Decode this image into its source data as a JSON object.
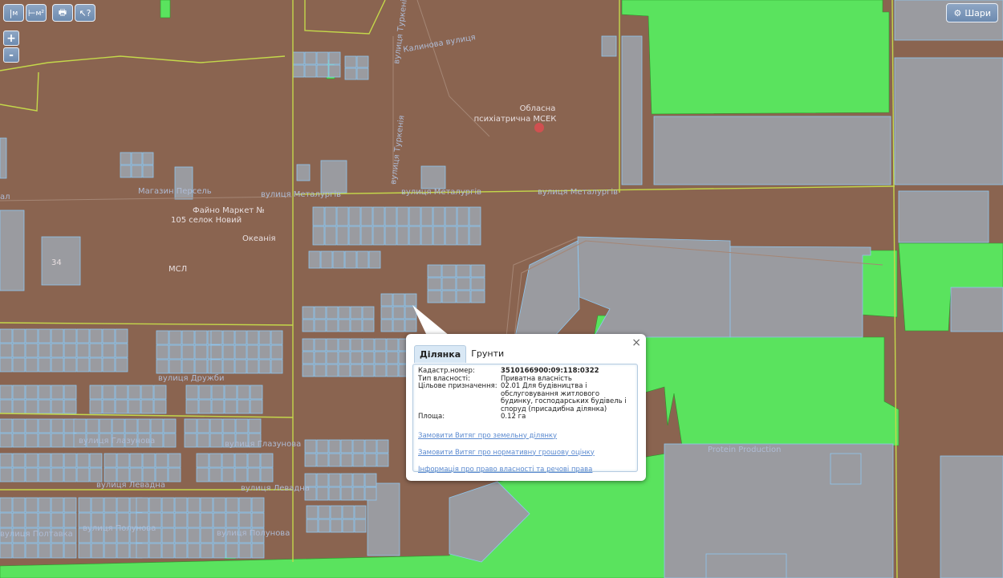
{
  "toolbar": {
    "ruler_label": "м",
    "area_label": "м²",
    "print_icon": "printer-icon",
    "info_icon": "pointer-question-icon"
  },
  "zoom": {
    "in_label": "+",
    "out_label": "-"
  },
  "layers_button": {
    "label": "Шари",
    "icon": "gear-icon"
  },
  "map_labels": {
    "kalynova": "Калинова вулиця",
    "turkenia": "вулиця Туркенія",
    "turkenia2": "вулиця Туркенія",
    "clinic": "Обласна",
    "clinic2": "психіатрична МСЕК",
    "shop": "Магазин Персель",
    "faino": "Файно Маркет №",
    "faino2": "105 селок Новий",
    "okeaniia": "Океанія",
    "msl": "МСЛ",
    "n34": "34",
    "metalurhiv1": "вулиця Металургів",
    "metalurhiv2": "вулиця Металургів",
    "metalurhiv3": "вулиця Металургів",
    "druzhby": "вулиця Дружби",
    "hlazunova": "вулиця Глазунова",
    "hlazunova2": "вулиця Глазунова",
    "levadna": "вулиця Левадна",
    "levadna2": "вулиця Левадна",
    "polunova": "вулиця Полунова",
    "polunova2": "вулиця Полунова",
    "poltava": "вулиця Полтавка",
    "protein": "Protein Production",
    "al": "ал"
  },
  "popup": {
    "tabs": [
      "Ділянка",
      "Грунти"
    ],
    "close_label": "×",
    "fields": [
      {
        "key": "Кадастр.номер:",
        "value": "3510166900:09:118:0322",
        "bold": true
      },
      {
        "key": "Тип власності:",
        "value": "Приватна власність"
      },
      {
        "key": "Цільове призначення:",
        "value": "02.01 Для будівництва і обслуговування житлового будинку, господарських будівель і споруд (присадибна ділянка)"
      },
      {
        "key": "Площа:",
        "value": "0.12 га"
      }
    ],
    "links": [
      "Замовити Витяг про земельну ділянку",
      "Замовити Витяг про нормативну грошову оцінку",
      "Інформація про право власності та речові права"
    ]
  },
  "colors": {
    "land": "#8a6450",
    "green": "#5ae35e",
    "parcel_fill": "#9a9ba0",
    "parcel_stroke": "#8ec7f0",
    "road": "#c4d84a",
    "link": "#5b8ad0"
  }
}
